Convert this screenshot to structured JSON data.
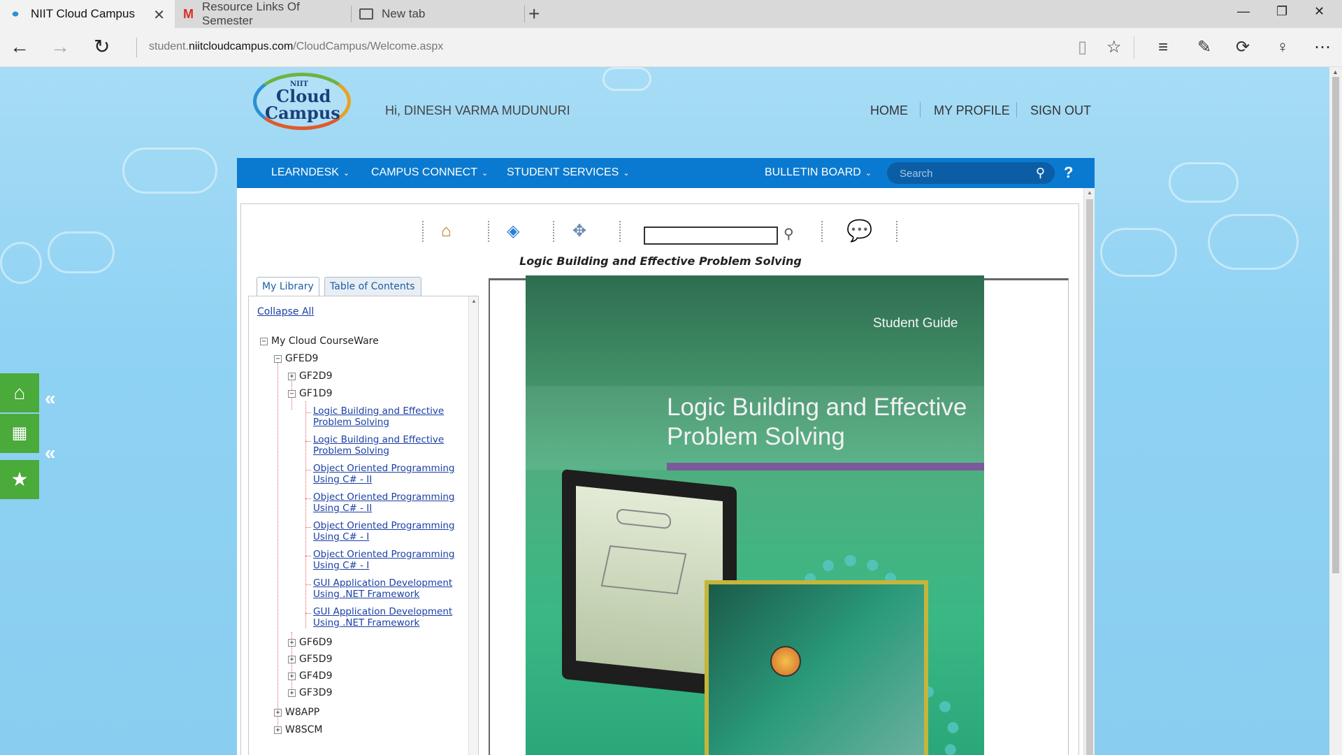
{
  "browser": {
    "tabs": [
      {
        "title": "NIIT Cloud Campus",
        "active": true
      },
      {
        "title": "Resource Links Of Semester",
        "active": false
      },
      {
        "title": "New tab",
        "active": false
      }
    ],
    "url_host": "student.niitcloudcampus.com",
    "url_prefix": "student.",
    "url_domain": "niitcloudcampus.com",
    "url_path": "/CloudCampus/Welcome.aspx"
  },
  "header": {
    "logo_top": "NIIT",
    "logo_cloud": "Cloud",
    "logo_campus": "Campus",
    "greeting": "Hi, DINESH VARMA MUDUNURI",
    "links": [
      "HOME",
      "MY PROFILE",
      "SIGN OUT"
    ]
  },
  "menubar": {
    "items": [
      "LEARNDESK",
      "CAMPUS CONNECT",
      "STUDENT SERVICES",
      "BULLETIN BOARD"
    ],
    "search_placeholder": "Search",
    "help": "?"
  },
  "viewer": {
    "document_title": "Logic Building and Effective Problem Solving",
    "search_value": ""
  },
  "library": {
    "tabs": [
      "My Library",
      "Table of Contents"
    ],
    "collapse_all": "Collapse All",
    "root": "My Cloud CourseWare",
    "gfed9": "GFED9",
    "gf2d9": "GF2D9",
    "gf1d9": "GF1D9",
    "leaves": [
      "Logic Building and Effective Problem Solving",
      "Logic Building and Effective Problem Solving",
      "Object Oriented Programming Using C# - II",
      "Object Oriented Programming Using C# - II",
      "Object Oriented Programming Using C# - I",
      "Object Oriented Programming Using C# - I",
      "GUI Application Development Using .NET Framework",
      "GUI Application Development Using .NET Framework"
    ],
    "other_modules": [
      "GF6D9",
      "GF5D9",
      "GF4D9",
      "GF3D9"
    ],
    "top_modules": [
      "W8APP",
      "W8SCM"
    ]
  },
  "cover": {
    "label": "Student Guide",
    "title": "Logic Building and Effective Problem Solving"
  },
  "colors": {
    "menubar": "#0a7ad0",
    "side_buttons": "#4aaa3a",
    "link": "#1a3fa6"
  }
}
